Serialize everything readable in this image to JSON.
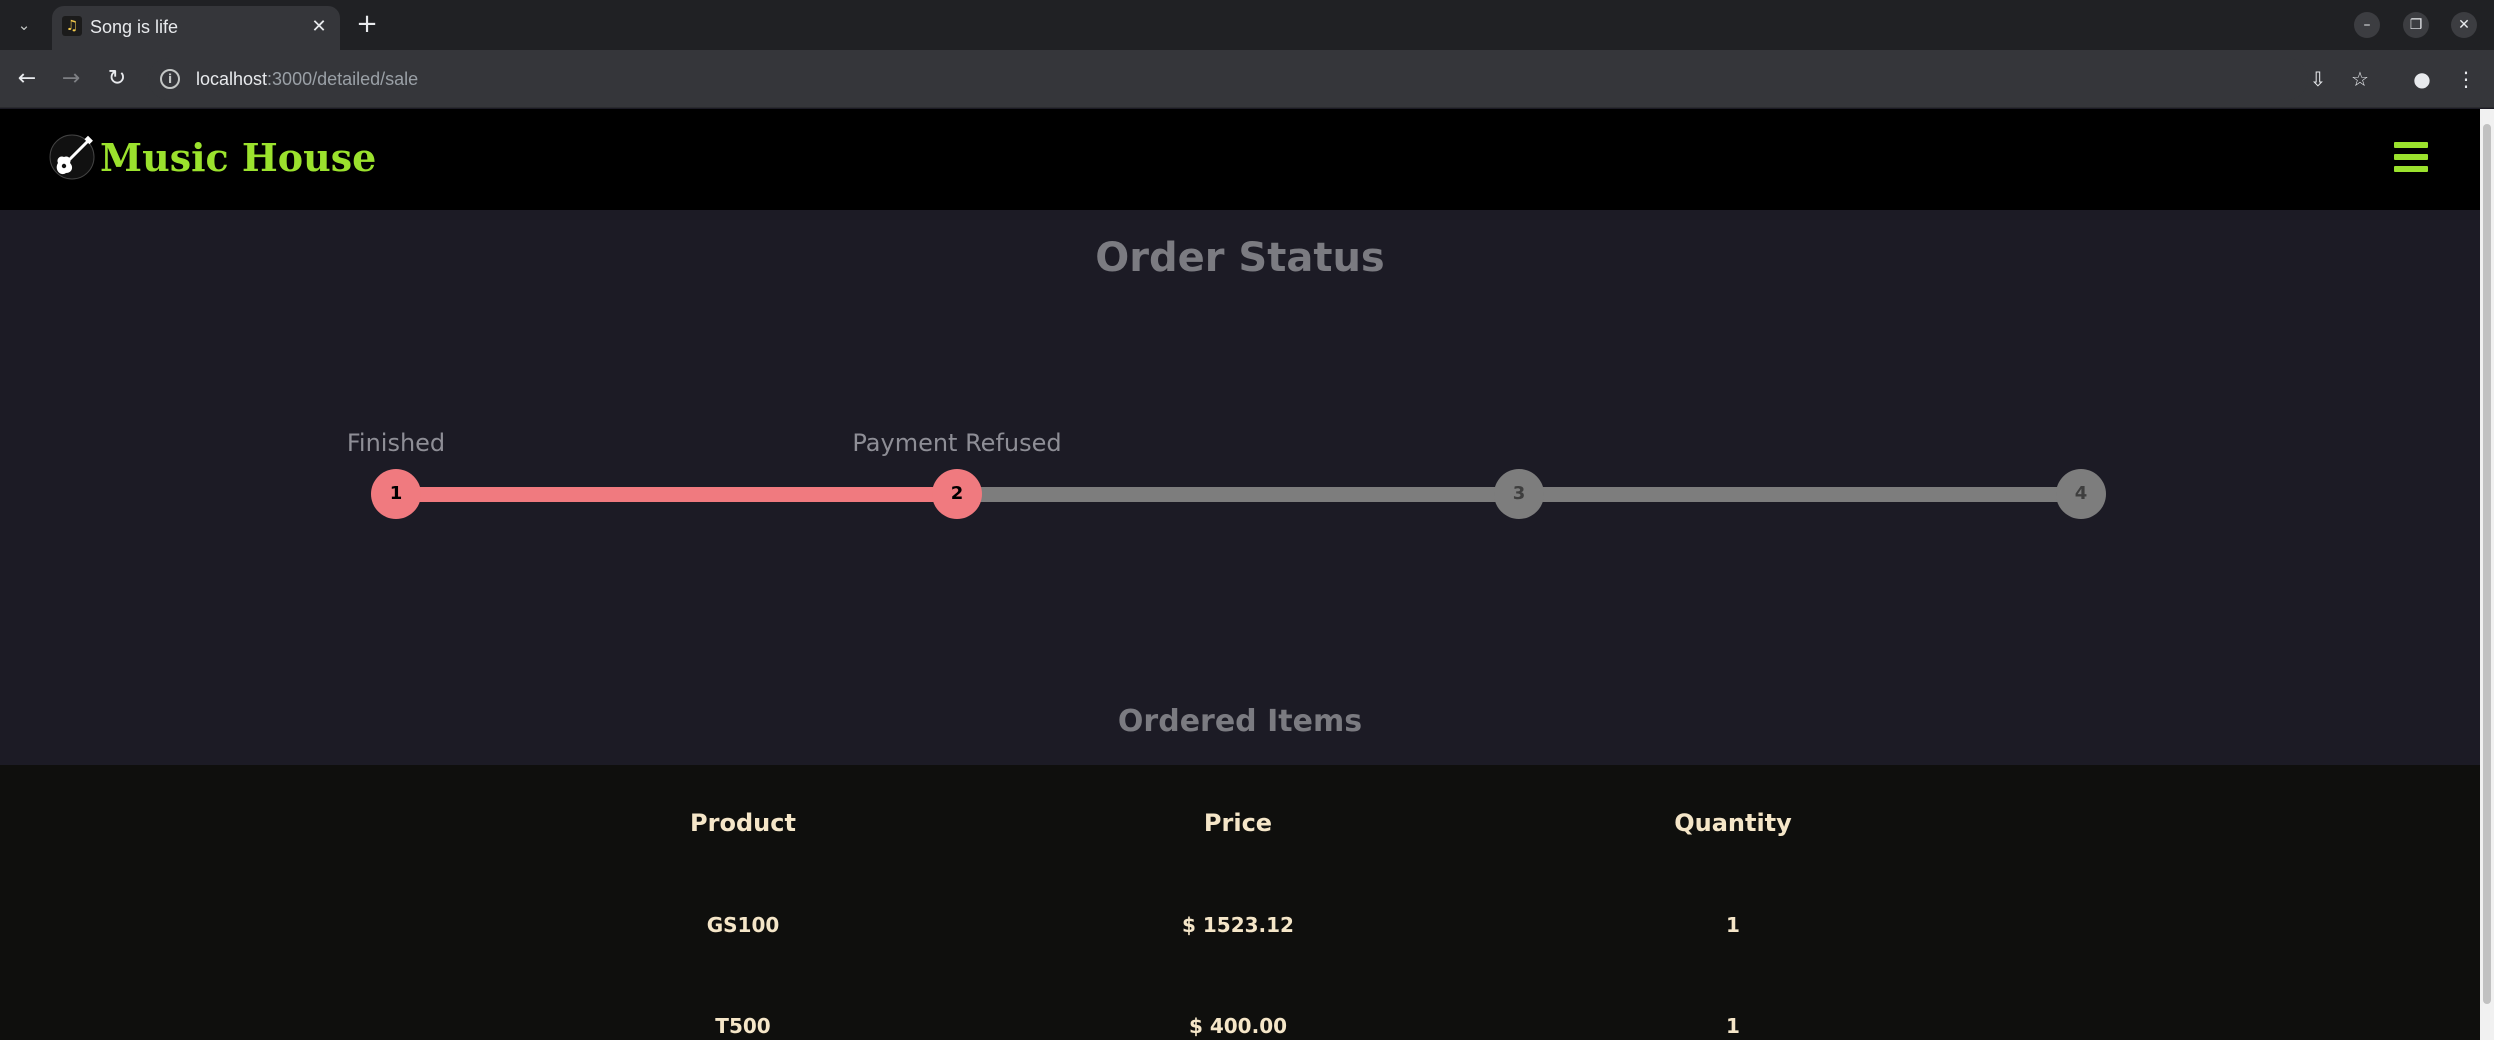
{
  "browser": {
    "tab_title": "Song is life",
    "url_host": "localhost",
    "url_path": ":3000/detailed/sale"
  },
  "header": {
    "brand": "Music House"
  },
  "order_status": {
    "title": "Order Status",
    "steps": [
      {
        "number": "1",
        "label": "Finished",
        "state": "done"
      },
      {
        "number": "2",
        "label": "Payment Refused",
        "state": "done"
      },
      {
        "number": "3",
        "label": "",
        "state": "todo"
      },
      {
        "number": "4",
        "label": "",
        "state": "todo"
      }
    ]
  },
  "ordered_items": {
    "title": "Ordered Items",
    "columns": [
      "Product",
      "Price",
      "Quantity"
    ],
    "rows": [
      [
        "GS100",
        "$ 1523.12",
        "1"
      ],
      [
        "T500",
        "$ 400.00",
        "1"
      ]
    ]
  },
  "colors": {
    "brand": "#9be22d",
    "step_done": "#f07a7f",
    "step_todo": "#7d7d7d"
  }
}
